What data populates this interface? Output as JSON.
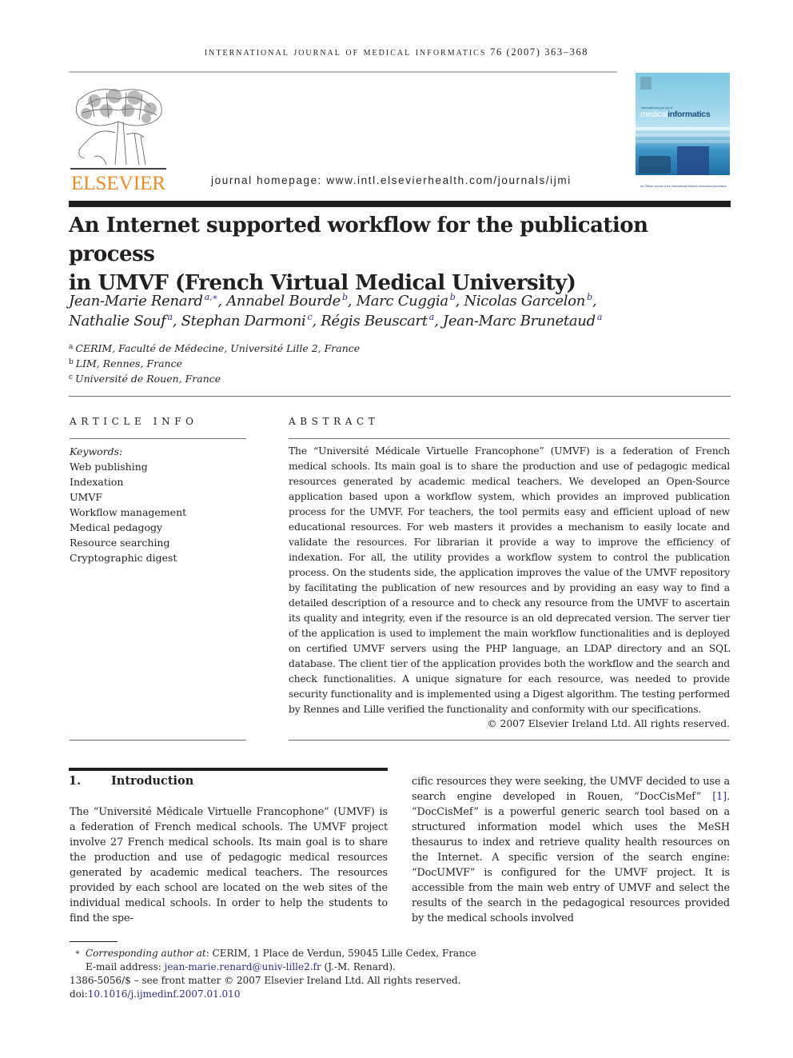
{
  "header": {
    "running_head": "International Journal of Medical Informatics",
    "running_volume": "76 (2007) 363–368",
    "publisher_logo_text": "ELSEVIER",
    "homepage": "journal homepage: www.intl.elsevierhealth.com/journals/ijmi",
    "cover": {
      "small_text": "international journal of",
      "title_light": "medical",
      "title_bold": "informatics",
      "caption": "An Official Journal of the International Medical Informatics Association"
    }
  },
  "article": {
    "title_line1": "An Internet supported workflow for the publication process",
    "title_line2": "in UMVF (French Virtual Medical University)",
    "authors": [
      {
        "name": "Jean-Marie Renard",
        "sup": "a,∗",
        "sep": ", "
      },
      {
        "name": "Annabel Bourde",
        "sup": "b",
        "sep": ", "
      },
      {
        "name": "Marc Cuggia",
        "sup": "b",
        "sep": ", "
      },
      {
        "name": "Nicolas Garcelon",
        "sup": "b",
        "sep": ","
      },
      {
        "name": "Nathalie Souf",
        "sup": "a",
        "sep": ", "
      },
      {
        "name": "Stephan Darmoni",
        "sup": "c",
        "sep": ", "
      },
      {
        "name": "Régis Beuscart",
        "sup": "a",
        "sep": ", "
      },
      {
        "name": "Jean-Marc Brunetaud",
        "sup": "a",
        "sep": ""
      }
    ],
    "affiliations": [
      {
        "key": "a",
        "text": "CERIM, Faculté de Médecine, Université Lille 2, France"
      },
      {
        "key": "b",
        "text": "LIM, Rennes, France"
      },
      {
        "key": "c",
        "text": "Université de Rouen, France"
      }
    ]
  },
  "article_info": {
    "heading": "ARTICLE INFO",
    "keywords_label": "Keywords:",
    "keywords": [
      "Web publishing",
      "Indexation",
      "UMVF",
      "Workflow management",
      "Medical pedagogy",
      "Resource searching",
      "Cryptographic digest"
    ]
  },
  "abstract": {
    "heading": "ABSTRACT",
    "text": "The “Université Médicale Virtuelle Francophone” (UMVF) is a federation of French medical schools. Its main goal is to share the production and use of pedagogic medical resources generated by academic medical teachers. We developed an Open-Source application based upon a workflow system, which provides an improved publication process for the UMVF. For teachers, the tool permits easy and efficient upload of new educational resources. For web masters it provides a mechanism to easily locate and validate the resources. For librarian it provide a way to improve the efficiency of indexation. For all, the utility provides a workflow system to control the publication process. On the students side, the application improves the value of the UMVF repository by facilitating the publication of new resources and by providing an easy way to find a detailed description of a resource and to check any resource from the UMVF to ascertain its quality and integrity, even if the resource is an old deprecated version. The server tier of the application is used to implement the main workflow functionalities and is deployed on certified UMVF servers using the PHP language, an LDAP directory and an SQL database. The client tier of the application provides both the workflow and the search and check functionalities. A unique signature for each resource, was needed to provide security functionality and is implemented using a Digest algorithm. The testing performed by Rennes and Lille verified the functionality and conformity with our specifications.",
    "copyright": "© 2007 Elsevier Ireland Ltd. All rights reserved."
  },
  "introduction": {
    "number": "1.",
    "heading": "Introduction",
    "left_text": "The “Université Médicale Virtuelle Francophone” (UMVF) is a federation of French medical schools. The UMVF project involve 27 French medical schools. Its main goal is to share the production and use of pedagogic medical resources generated by academic medical teachers. The resources provided by each school are located on the web sites of the individual medical schools. In order to help the students to find the spe-",
    "right_text_before_ref": "cific resources they were seeking, the UMVF decided to use a search engine developed in Rouen, “DocCisMef” ",
    "ref": "[1]",
    "right_text_after_ref": ". “DocCisMef” is a powerful generic search tool based on a structured information model which uses the MeSH thesaurus to index and retrieve quality health resources on the Internet. A specific version of the search engine: “DocUMVF” is configured for the UMVF project. It is accessible from the main web entry of UMVF and select the results of the search in the pedagogical resources provided by the medical schools involved"
  },
  "footnotes": {
    "star": "∗",
    "corresponding_label": "Corresponding author at",
    "corresponding_text": ": CERIM, 1 Place de Verdun, 59045 Lille Cedex, France",
    "email_label": "E-mail address: ",
    "email": "jean-marie.renard@univ-lille2.fr",
    "email_suffix": " (J.-M. Renard).",
    "issn_line": "1386-5056/$ – see front matter © 2007 Elsevier Ireland Ltd. All rights reserved.",
    "doi_label": "doi:",
    "doi": "10.1016/j.ijmedinf.2007.01.010"
  },
  "colors": {
    "link": "#2b2e8c",
    "elsevier_orange": "#f08a24",
    "text": "#231f20"
  }
}
